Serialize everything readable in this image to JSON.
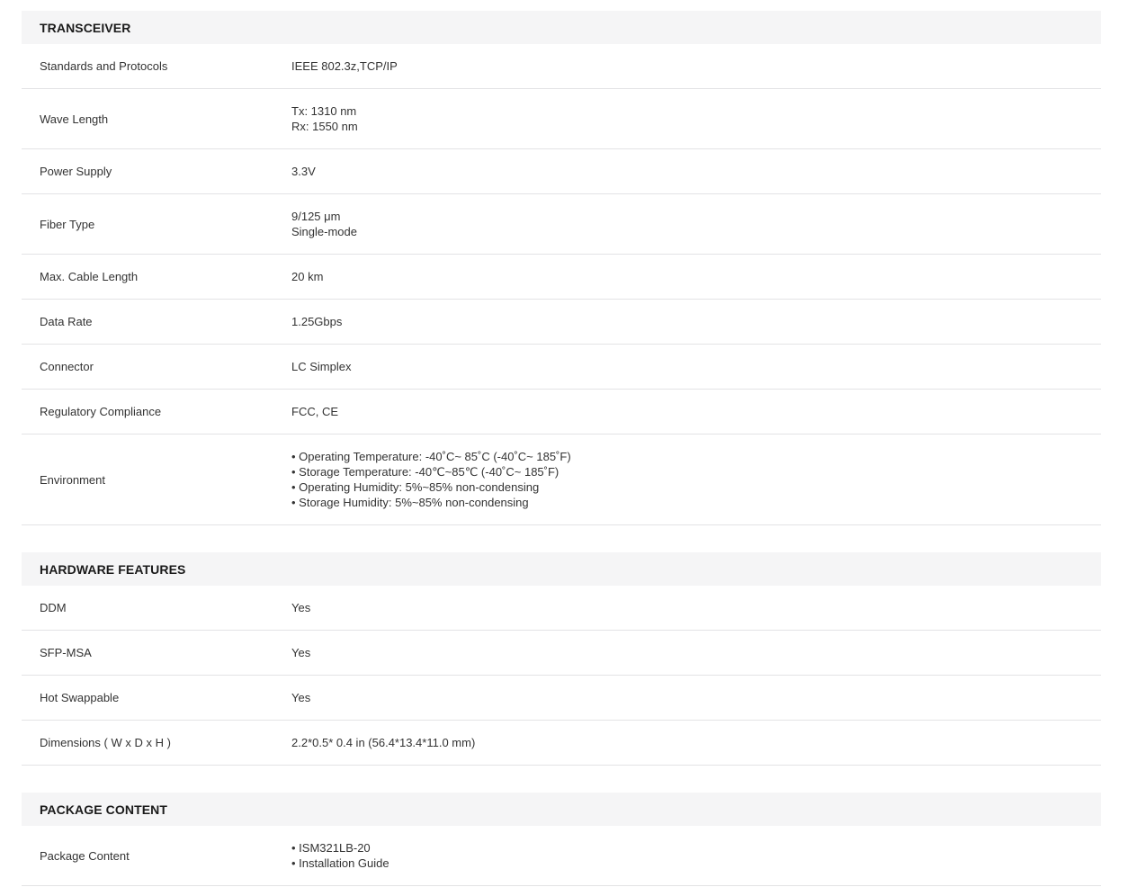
{
  "sections": [
    {
      "title": "TRANSCEIVER",
      "rows": [
        {
          "label": "Standards and Protocols",
          "lines": [
            "IEEE 802.3z,TCP/IP"
          ]
        },
        {
          "label": "Wave Length",
          "lines": [
            "Tx: 1310 nm",
            "Rx: 1550 nm"
          ]
        },
        {
          "label": "Power Supply",
          "lines": [
            "3.3V"
          ]
        },
        {
          "label": "Fiber Type",
          "lines": [
            "9/125 μm",
            "Single-mode"
          ]
        },
        {
          "label": "Max. Cable Length",
          "lines": [
            "20 km"
          ]
        },
        {
          "label": "Data Rate",
          "lines": [
            "1.25Gbps"
          ]
        },
        {
          "label": "Connector",
          "lines": [
            "LC Simplex"
          ]
        },
        {
          "label": "Regulatory Compliance",
          "lines": [
            "FCC, CE"
          ]
        },
        {
          "label": "Environment",
          "lines": [
            "• Operating Temperature: -40˚C~ 85˚C (-40˚C~ 185˚F)",
            "• Storage Temperature: -40℃~85℃ (-40˚C~ 185˚F)",
            "• Operating Humidity: 5%~85% non-condensing",
            "• Storage Humidity: 5%~85% non-condensing"
          ]
        }
      ]
    },
    {
      "title": "HARDWARE FEATURES",
      "rows": [
        {
          "label": "DDM",
          "lines": [
            "Yes"
          ]
        },
        {
          "label": "SFP-MSA",
          "lines": [
            "Yes"
          ]
        },
        {
          "label": "Hot Swappable",
          "lines": [
            "Yes"
          ]
        },
        {
          "label": "Dimensions ( W x D x H )",
          "lines": [
            "2.2*0.5* 0.4 in (56.4*13.4*11.0 mm)"
          ]
        }
      ]
    },
    {
      "title": "PACKAGE CONTENT",
      "rows": [
        {
          "label": "Package Content",
          "lines": [
            "• ISM321LB-20",
            "• Installation Guide"
          ]
        }
      ]
    }
  ]
}
